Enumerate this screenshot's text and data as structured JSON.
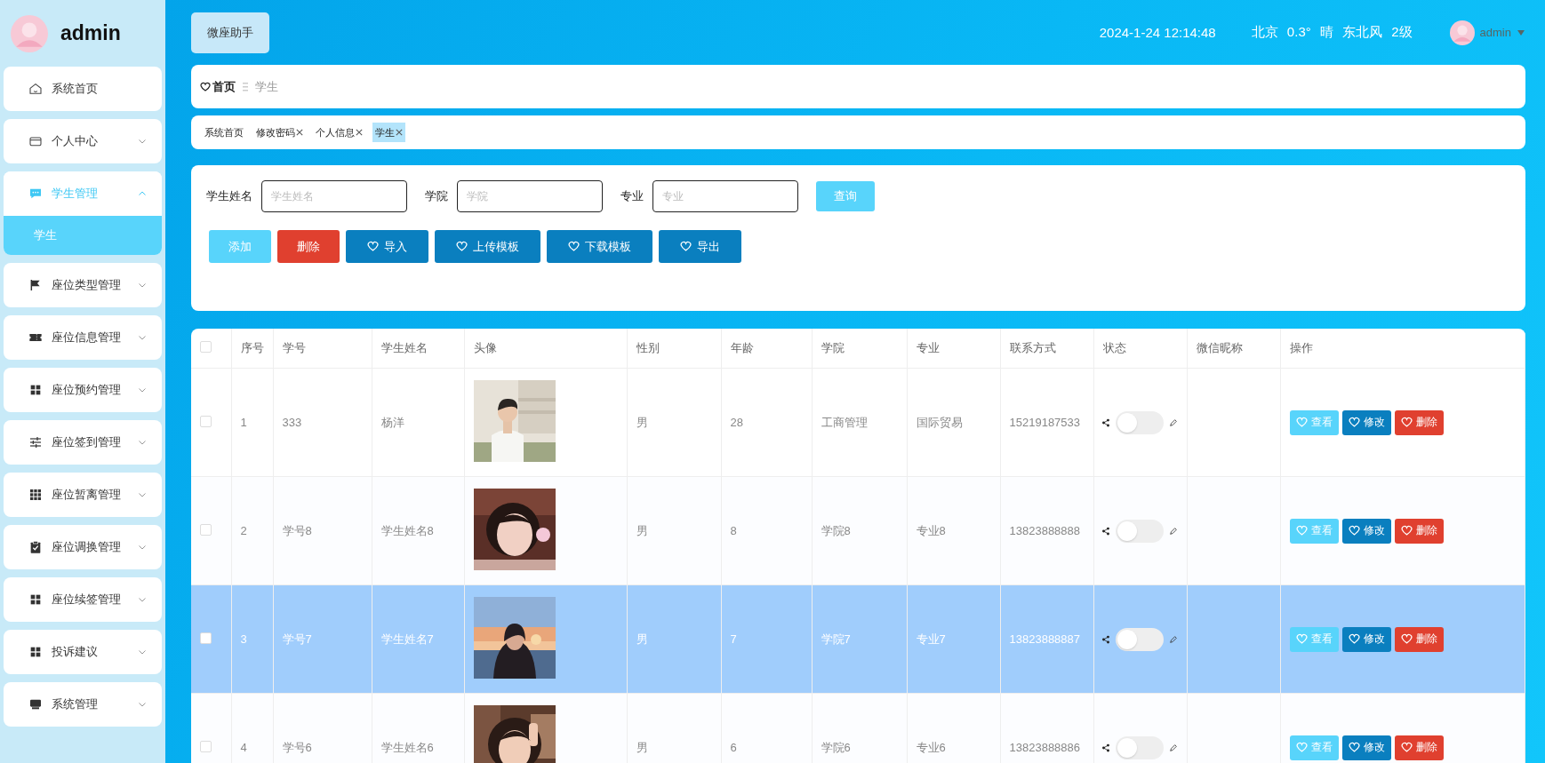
{
  "sidebar": {
    "brand": "admin",
    "items": [
      {
        "label": "系统首页",
        "kind": "link",
        "selected": false
      },
      {
        "label": "个人中心",
        "kind": "menu",
        "expanded": false,
        "selected": false
      },
      {
        "label": "学生管理",
        "kind": "menu",
        "expanded": true,
        "selected": true,
        "children": [
          {
            "label": "学生",
            "selected": true
          }
        ]
      },
      {
        "label": "座位类型管理",
        "kind": "menu",
        "expanded": false,
        "selected": false
      },
      {
        "label": "座位信息管理",
        "kind": "menu",
        "expanded": false,
        "selected": false
      },
      {
        "label": "座位预约管理",
        "kind": "menu",
        "expanded": false,
        "selected": false
      },
      {
        "label": "座位签到管理",
        "kind": "menu",
        "expanded": false,
        "selected": false
      },
      {
        "label": "座位暂离管理",
        "kind": "menu",
        "expanded": false,
        "selected": false
      },
      {
        "label": "座位调换管理",
        "kind": "menu",
        "expanded": false,
        "selected": false
      },
      {
        "label": "座位续签管理",
        "kind": "menu",
        "expanded": false,
        "selected": false
      },
      {
        "label": "投诉建议",
        "kind": "menu",
        "expanded": false,
        "selected": false
      },
      {
        "label": "系统管理",
        "kind": "menu",
        "expanded": false,
        "selected": false
      }
    ]
  },
  "header": {
    "assistant_button": "微座助手",
    "datetime": "2024-1-24 12:14:48",
    "weather": "北京 0.3° 晴 东北风 2级",
    "user": "admin"
  },
  "breadcrumb": [
    "首页",
    "学生"
  ],
  "tabs": [
    {
      "label": "系统首页",
      "closable": false,
      "selected": false
    },
    {
      "label": "修改密码",
      "closable": true,
      "selected": false
    },
    {
      "label": "个人信息",
      "closable": true,
      "selected": false
    },
    {
      "label": "学生",
      "closable": true,
      "selected": true
    }
  ],
  "search": {
    "fields": [
      {
        "label": "学生姓名",
        "placeholder": "学生姓名"
      },
      {
        "label": "学院",
        "placeholder": "学院"
      },
      {
        "label": "专业",
        "placeholder": "专业"
      }
    ],
    "button": "查询",
    "actions": [
      {
        "label": "添加",
        "kind": "add"
      },
      {
        "label": "删除",
        "kind": "delete"
      },
      {
        "label": "导入",
        "kind": "tool"
      },
      {
        "label": "上传模板",
        "kind": "tool"
      },
      {
        "label": "下载模板",
        "kind": "tool"
      },
      {
        "label": "导出",
        "kind": "tool"
      }
    ]
  },
  "table": {
    "header_checked": false,
    "columns": [
      "序号",
      "学号",
      "学生姓名",
      "头像",
      "性别",
      "年龄",
      "学院",
      "专业",
      "联系方式",
      "状态",
      "微信昵称",
      "操作"
    ],
    "rows": [
      {
        "selected": false,
        "checked": false,
        "index": "1",
        "student_no": "333",
        "name": "杨洋",
        "gender": "男",
        "age": "28",
        "college": "工商管理",
        "major": "国际贸易",
        "phone": "15219187533",
        "status_on": false,
        "actions": [
          {
            "label": "查看",
            "kind": "view"
          },
          {
            "label": "修改",
            "kind": "edit"
          },
          {
            "label": "删除",
            "kind": "delete"
          }
        ]
      },
      {
        "selected": false,
        "checked": false,
        "index": "2",
        "student_no": "学号8",
        "name": "学生姓名8",
        "gender": "男",
        "age": "8",
        "college": "学院8",
        "major": "专业8",
        "phone": "13823888888",
        "status_on": false,
        "actions": [
          {
            "label": "查看",
            "kind": "view"
          },
          {
            "label": "修改",
            "kind": "edit"
          },
          {
            "label": "删除",
            "kind": "delete"
          }
        ]
      },
      {
        "selected": true,
        "checked": false,
        "index": "3",
        "student_no": "学号7",
        "name": "学生姓名7",
        "gender": "男",
        "age": "7",
        "college": "学院7",
        "major": "专业7",
        "phone": "13823888887",
        "status_on": false,
        "actions": [
          {
            "label": "查看",
            "kind": "view"
          },
          {
            "label": "修改",
            "kind": "edit"
          },
          {
            "label": "删除",
            "kind": "delete"
          }
        ]
      },
      {
        "selected": false,
        "checked": false,
        "index": "4",
        "student_no": "学号6",
        "name": "学生姓名6",
        "gender": "男",
        "age": "6",
        "college": "学院6",
        "major": "专业6",
        "phone": "13823888886",
        "status_on": false,
        "actions": [
          {
            "label": "查看",
            "kind": "view"
          },
          {
            "label": "修改",
            "kind": "edit"
          },
          {
            "label": "删除",
            "kind": "delete"
          }
        ]
      }
    ]
  }
}
